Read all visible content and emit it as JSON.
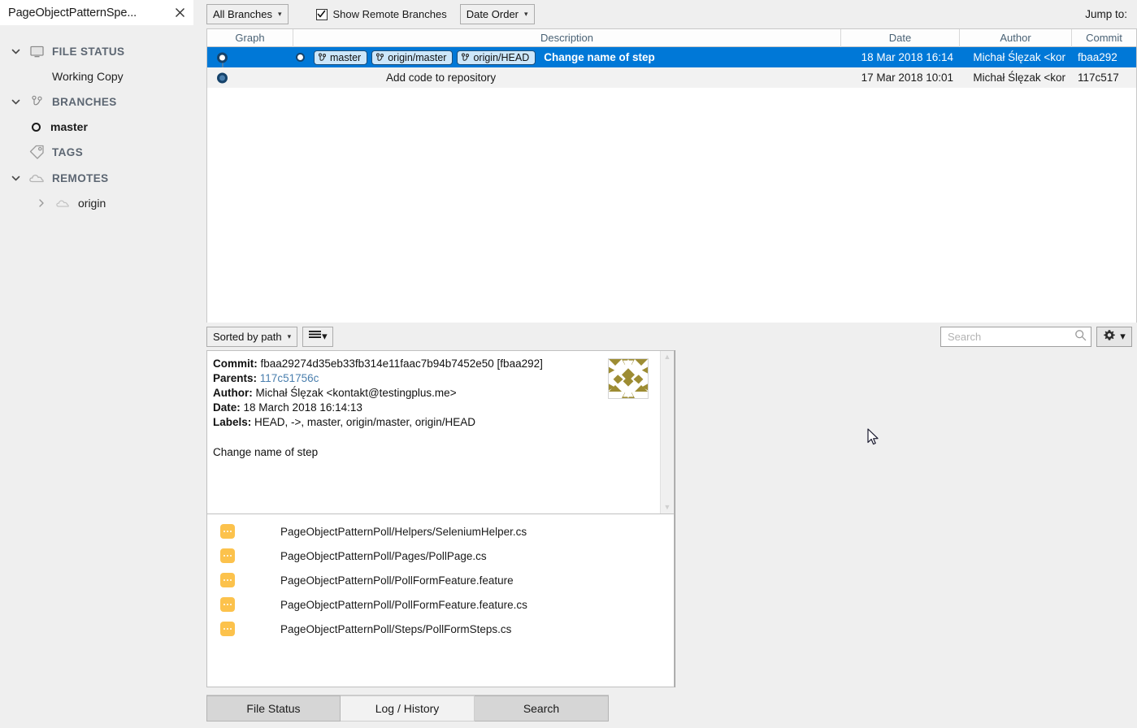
{
  "window": {
    "tab_title": "PageObjectPatternSpe...",
    "close_icon": "close-icon"
  },
  "sidebar": {
    "sections": [
      {
        "label": "FILE STATUS",
        "icon": "monitor-icon",
        "expanded": true
      },
      {
        "label": "BRANCHES",
        "icon": "branch-icon",
        "expanded": true
      },
      {
        "label": "TAGS",
        "icon": "tag-icon",
        "expanded": false
      },
      {
        "label": "REMOTES",
        "icon": "cloud-icon",
        "expanded": true
      }
    ],
    "working_copy": "Working Copy",
    "branch_item": "master",
    "remote_item": "origin"
  },
  "log_toolbar": {
    "branch_filter": "All Branches",
    "show_remote_branches": "Show Remote Branches",
    "show_remote_checked": true,
    "order": "Date Order",
    "jump_to": "Jump to:"
  },
  "commit_table": {
    "columns": [
      "Graph",
      "Description",
      "Date",
      "Author",
      "Commit"
    ],
    "rows": [
      {
        "refs": [
          "master",
          "origin/master",
          "origin/HEAD"
        ],
        "description": "Change name of step",
        "date": "18 Mar 2018 16:14",
        "author": "Michał Ślęzak <kor",
        "commit": "fbaa292",
        "selected": true,
        "head": true
      },
      {
        "refs": [],
        "description": "Add code to repository",
        "date": "17 Mar 2018 10:01",
        "author": "Michał Ślęzak <kor",
        "commit": "117c517",
        "selected": false,
        "head": false
      }
    ]
  },
  "mid_toolbar": {
    "sort": "Sorted by path",
    "view_icon": "list-view-icon",
    "search_placeholder": "Search",
    "search_value": "",
    "search_icon": "search-icon",
    "gear_icon": "gear-icon"
  },
  "detail": {
    "labels": {
      "commit": "Commit:",
      "parents": "Parents:",
      "author": "Author:",
      "date": "Date:",
      "labels": "Labels:"
    },
    "commit_hash": "fbaa29274d35eb33fb314e11faac7b94b7452e50 [fbaa292]",
    "parents": "117c51756c",
    "author": "Michał Ślęzak <kontakt@testingplus.me>",
    "date": "18 March 2018 16:14:13",
    "labels_value": "HEAD, ->, master, origin/master, origin/HEAD",
    "message": "Change name of step",
    "avatar": "identicon-avatar",
    "avatar_color": "#9d8c33"
  },
  "files": [
    {
      "status_icon": "modified-file-icon",
      "path": "PageObjectPatternPoll/Helpers/SeleniumHelper.cs"
    },
    {
      "status_icon": "modified-file-icon",
      "path": "PageObjectPatternPoll/Pages/PollPage.cs"
    },
    {
      "status_icon": "modified-file-icon",
      "path": "PageObjectPatternPoll/PollFormFeature.feature"
    },
    {
      "status_icon": "modified-file-icon",
      "path": "PageObjectPatternPoll/PollFormFeature.feature.cs"
    },
    {
      "status_icon": "modified-file-icon",
      "path": "PageObjectPatternPoll/Steps/PollFormSteps.cs"
    }
  ],
  "bottom_tabs": [
    {
      "label": "File Status",
      "active": false
    },
    {
      "label": "Log / History",
      "active": true
    },
    {
      "label": "Search",
      "active": false
    }
  ],
  "colors": {
    "selection": "#0078d7",
    "accent_blue": "#4a7fae",
    "file_icon": "#fcc24c",
    "header_text": "#4a6275"
  }
}
